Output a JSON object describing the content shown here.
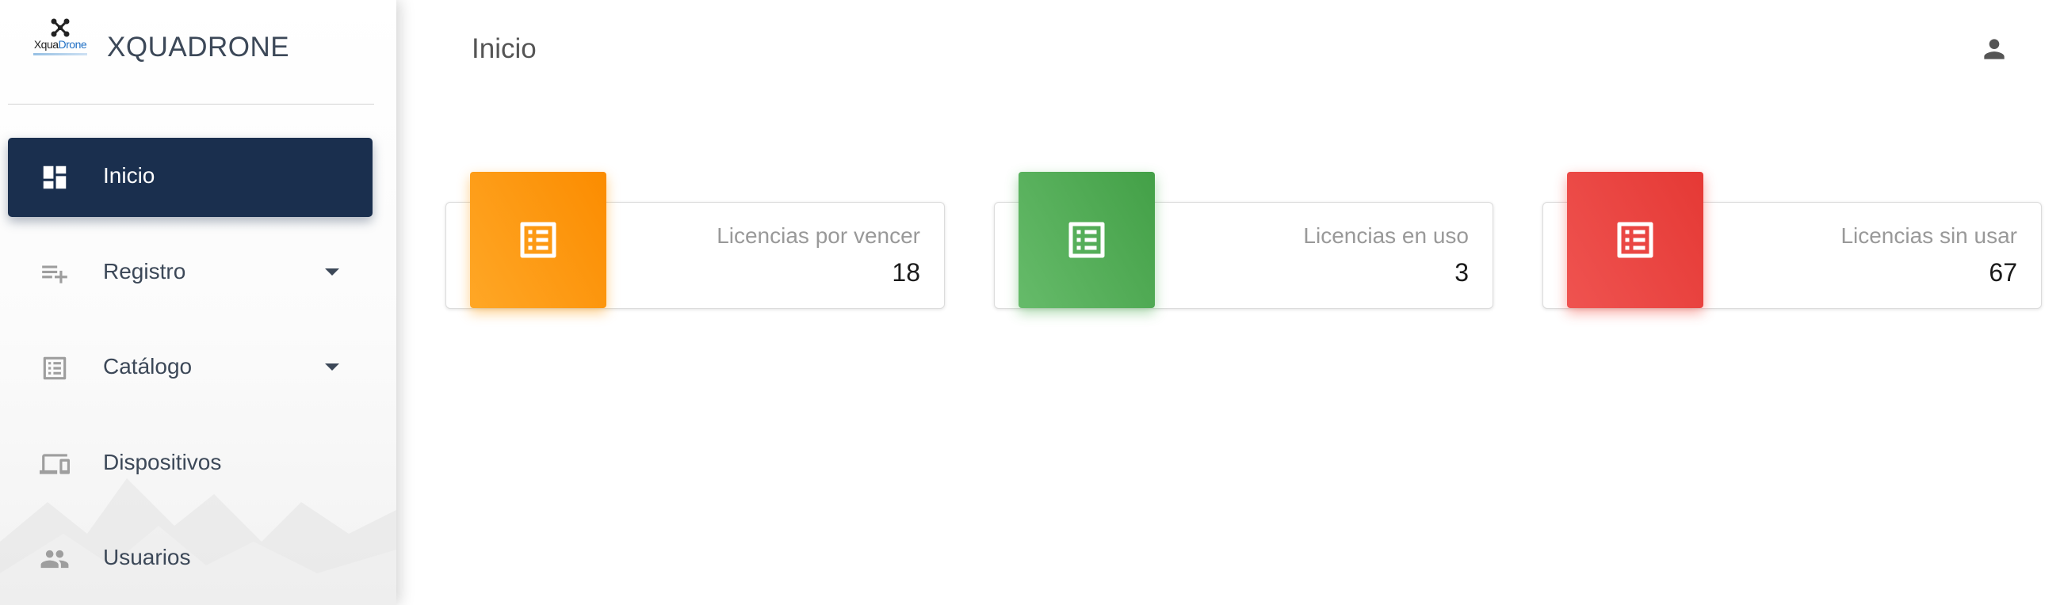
{
  "brand": {
    "logo_text_dark": "Xqua",
    "logo_text_blue": "Drone",
    "title": "XQUADRONE"
  },
  "sidebar": {
    "items": [
      {
        "label": "Inicio",
        "icon": "dashboard-icon",
        "active": true,
        "has_caret": false
      },
      {
        "label": "Registro",
        "icon": "playlist-add-icon",
        "active": false,
        "has_caret": true
      },
      {
        "label": "Catálogo",
        "icon": "list-alt-icon",
        "active": false,
        "has_caret": true
      },
      {
        "label": "Dispositivos",
        "icon": "devices-icon",
        "active": false,
        "has_caret": false
      },
      {
        "label": "Usuarios",
        "icon": "people-icon",
        "active": false,
        "has_caret": false
      }
    ]
  },
  "header": {
    "title": "Inicio",
    "user_icon": "person-icon"
  },
  "stats": [
    {
      "category": "Licencias por vencer",
      "value": "18",
      "color": "#fb8c00",
      "icon": "list-alt-icon"
    },
    {
      "category": "Licencias en uso",
      "value": "3",
      "color": "#43a047",
      "icon": "list-alt-icon"
    },
    {
      "category": "Licencias sin usar",
      "value": "67",
      "color": "#e53935",
      "icon": "list-alt-icon"
    }
  ],
  "colors": {
    "sidebar_active": "#1a2f4e",
    "text": "#3c4858",
    "muted": "#999999"
  }
}
